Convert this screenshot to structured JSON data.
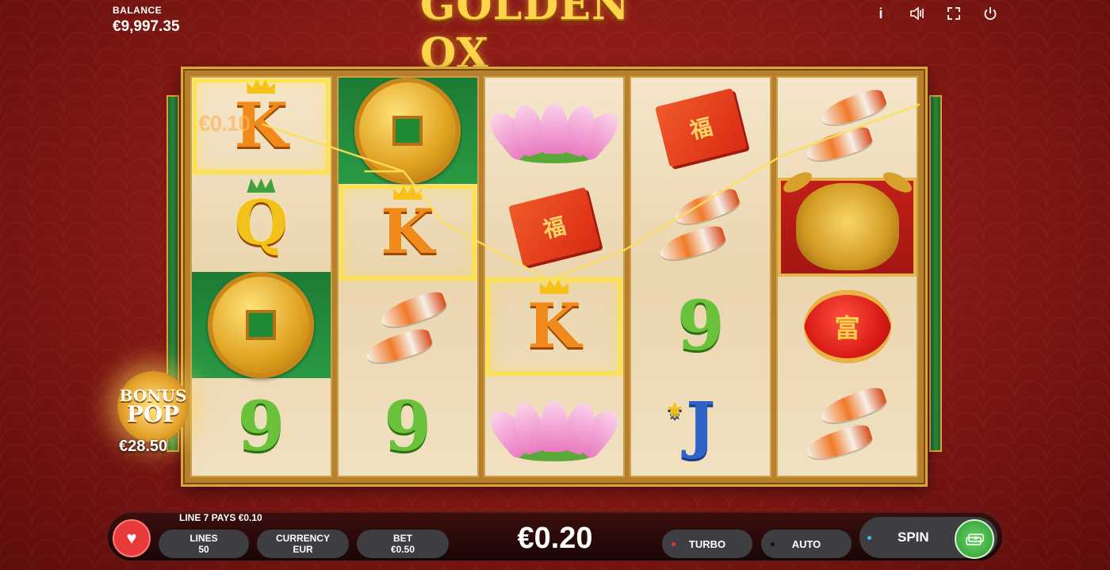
{
  "balance": {
    "label": "BALANCE",
    "value": "€9,997.35"
  },
  "logo": {
    "text": "GOLDEN OX"
  },
  "top_icons": [
    "info-icon",
    "sound-icon",
    "fullscreen-icon",
    "power-icon"
  ],
  "reels": [
    [
      {
        "symbol": "K",
        "win": true,
        "overlay": "€0.10"
      },
      {
        "symbol": "Q"
      },
      {
        "symbol": "coin"
      },
      {
        "symbol": "9"
      }
    ],
    [
      {
        "symbol": "coin"
      },
      {
        "symbol": "K",
        "win": true
      },
      {
        "symbol": "koi"
      },
      {
        "symbol": "9"
      }
    ],
    [
      {
        "symbol": "lotus"
      },
      {
        "symbol": "envelope",
        "text": "福"
      },
      {
        "symbol": "K",
        "win": true
      },
      {
        "symbol": "lotus"
      }
    ],
    [
      {
        "symbol": "envelope",
        "text": "福"
      },
      {
        "symbol": "koi"
      },
      {
        "symbol": "9"
      },
      {
        "symbol": "J"
      }
    ],
    [
      {
        "symbol": "koi"
      },
      {
        "symbol": "ox"
      },
      {
        "symbol": "lantern",
        "text": "富"
      },
      {
        "symbol": "koi"
      }
    ]
  ],
  "bonus": {
    "line1": "BONUS",
    "line2": "POP",
    "value": "€28.50"
  },
  "message": "LINE 7 PAYS €0.10",
  "controls": {
    "lines": {
      "label": "LINES",
      "value": "50"
    },
    "currency": {
      "label": "CURRENCY",
      "value": "EUR"
    },
    "bet": {
      "label": "BET",
      "value": "€0.50"
    },
    "win_amount": "€0.20",
    "turbo": "TURBO",
    "auto": "AUTO",
    "spin": "SPIN"
  },
  "colors": {
    "gold": "#d9a63a",
    "win_highlight": "#ffe24a",
    "turbo_dot": "#e23a3a",
    "spin_dot": "#4ab8e6"
  }
}
